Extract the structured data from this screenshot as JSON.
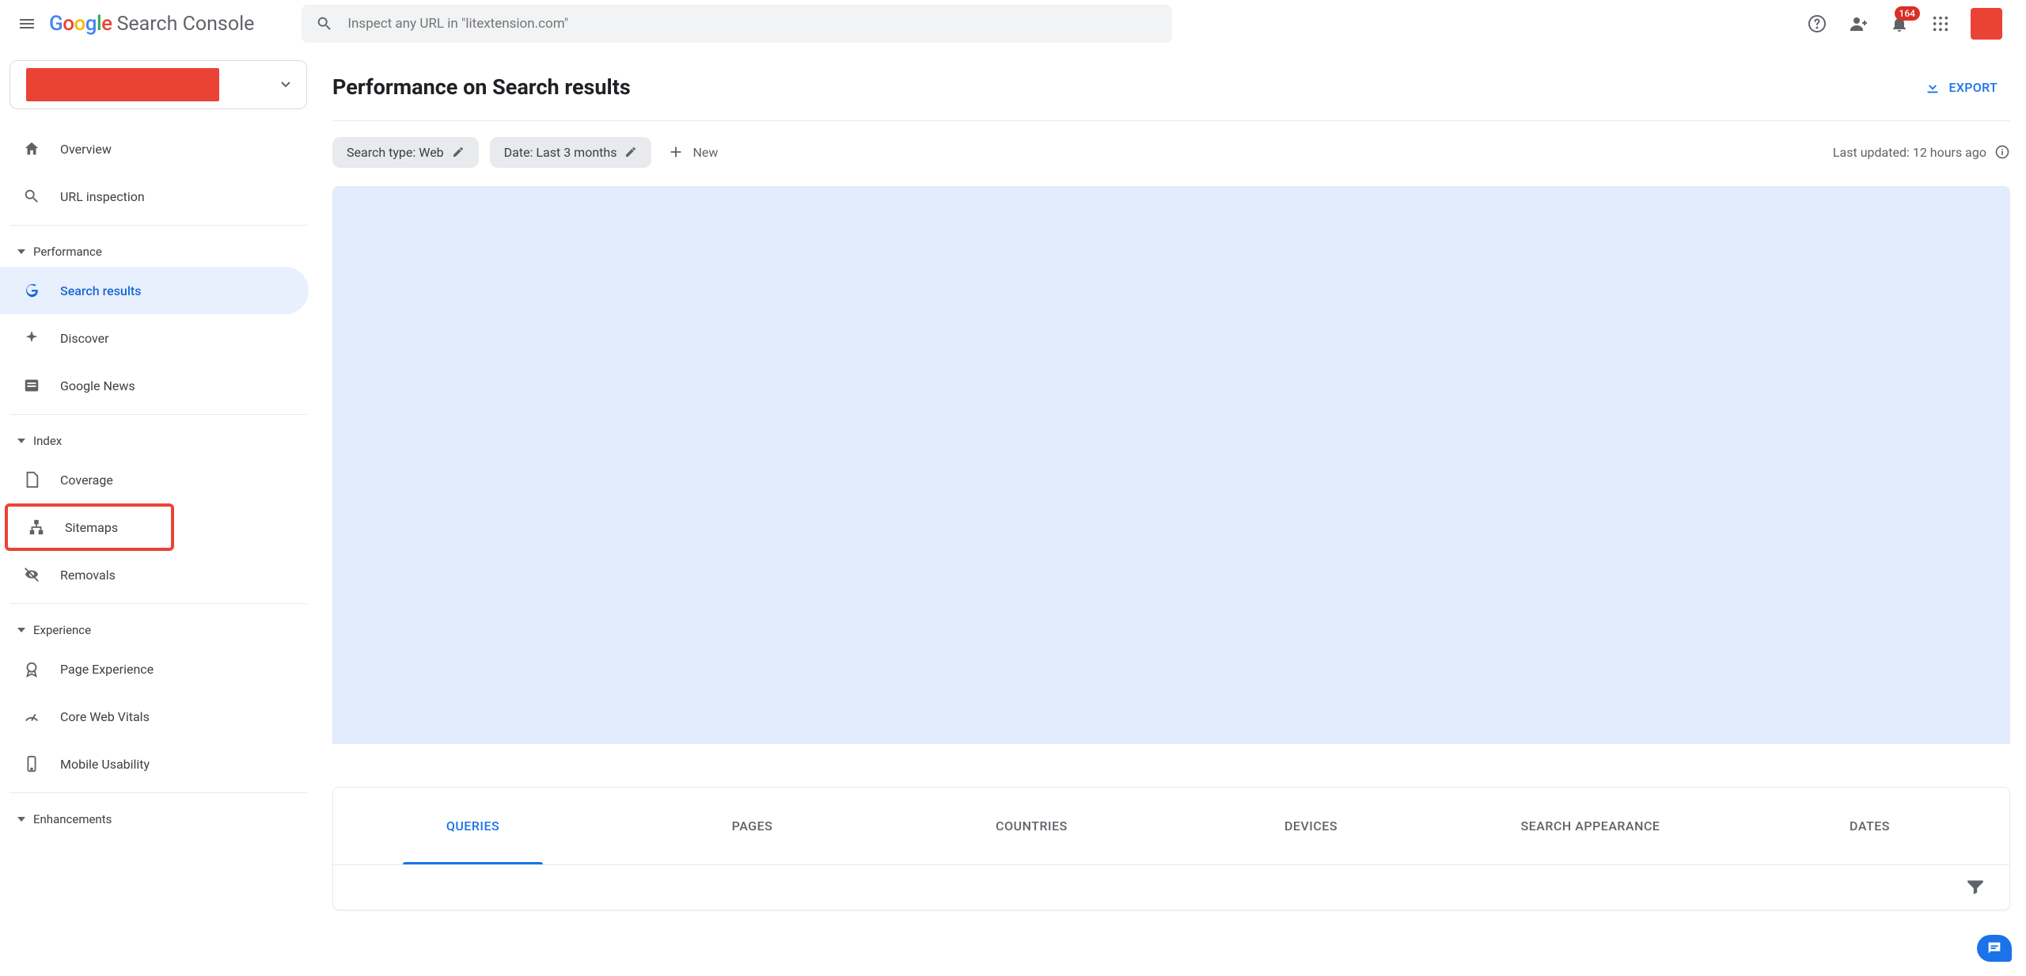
{
  "header": {
    "brand_name": "Search Console",
    "search_placeholder": "Inspect any URL in \"litextension.com\"",
    "notification_count": "164"
  },
  "sidebar": {
    "items_top": [
      {
        "label": "Overview"
      },
      {
        "label": "URL inspection"
      }
    ],
    "section_performance": "Performance",
    "items_performance": [
      {
        "label": "Search results"
      },
      {
        "label": "Discover"
      },
      {
        "label": "Google News"
      }
    ],
    "section_index": "Index",
    "items_index": [
      {
        "label": "Coverage"
      },
      {
        "label": "Sitemaps"
      },
      {
        "label": "Removals"
      }
    ],
    "section_experience": "Experience",
    "items_experience": [
      {
        "label": "Page Experience"
      },
      {
        "label": "Core Web Vitals"
      },
      {
        "label": "Mobile Usability"
      }
    ],
    "section_enhancements": "Enhancements"
  },
  "main": {
    "page_title": "Performance on Search results",
    "export_label": "EXPORT",
    "chip_search_type": "Search type: Web",
    "chip_date": "Date: Last 3 months",
    "chip_new": "New",
    "last_updated": "Last updated: 12 hours ago",
    "tabs": [
      {
        "label": "QUERIES"
      },
      {
        "label": "PAGES"
      },
      {
        "label": "COUNTRIES"
      },
      {
        "label": "DEVICES"
      },
      {
        "label": "SEARCH APPEARANCE"
      },
      {
        "label": "DATES"
      }
    ]
  },
  "colors": {
    "accent": "#1a73e8",
    "chart_bg": "#e2ecfc",
    "active_nav_bg": "#e8f0fe",
    "highlight": "#ea4335"
  },
  "chart_data": {
    "type": "area",
    "title": "",
    "note": "chart content obscured in screenshot; only blank blue area visible",
    "series": [],
    "x": []
  }
}
